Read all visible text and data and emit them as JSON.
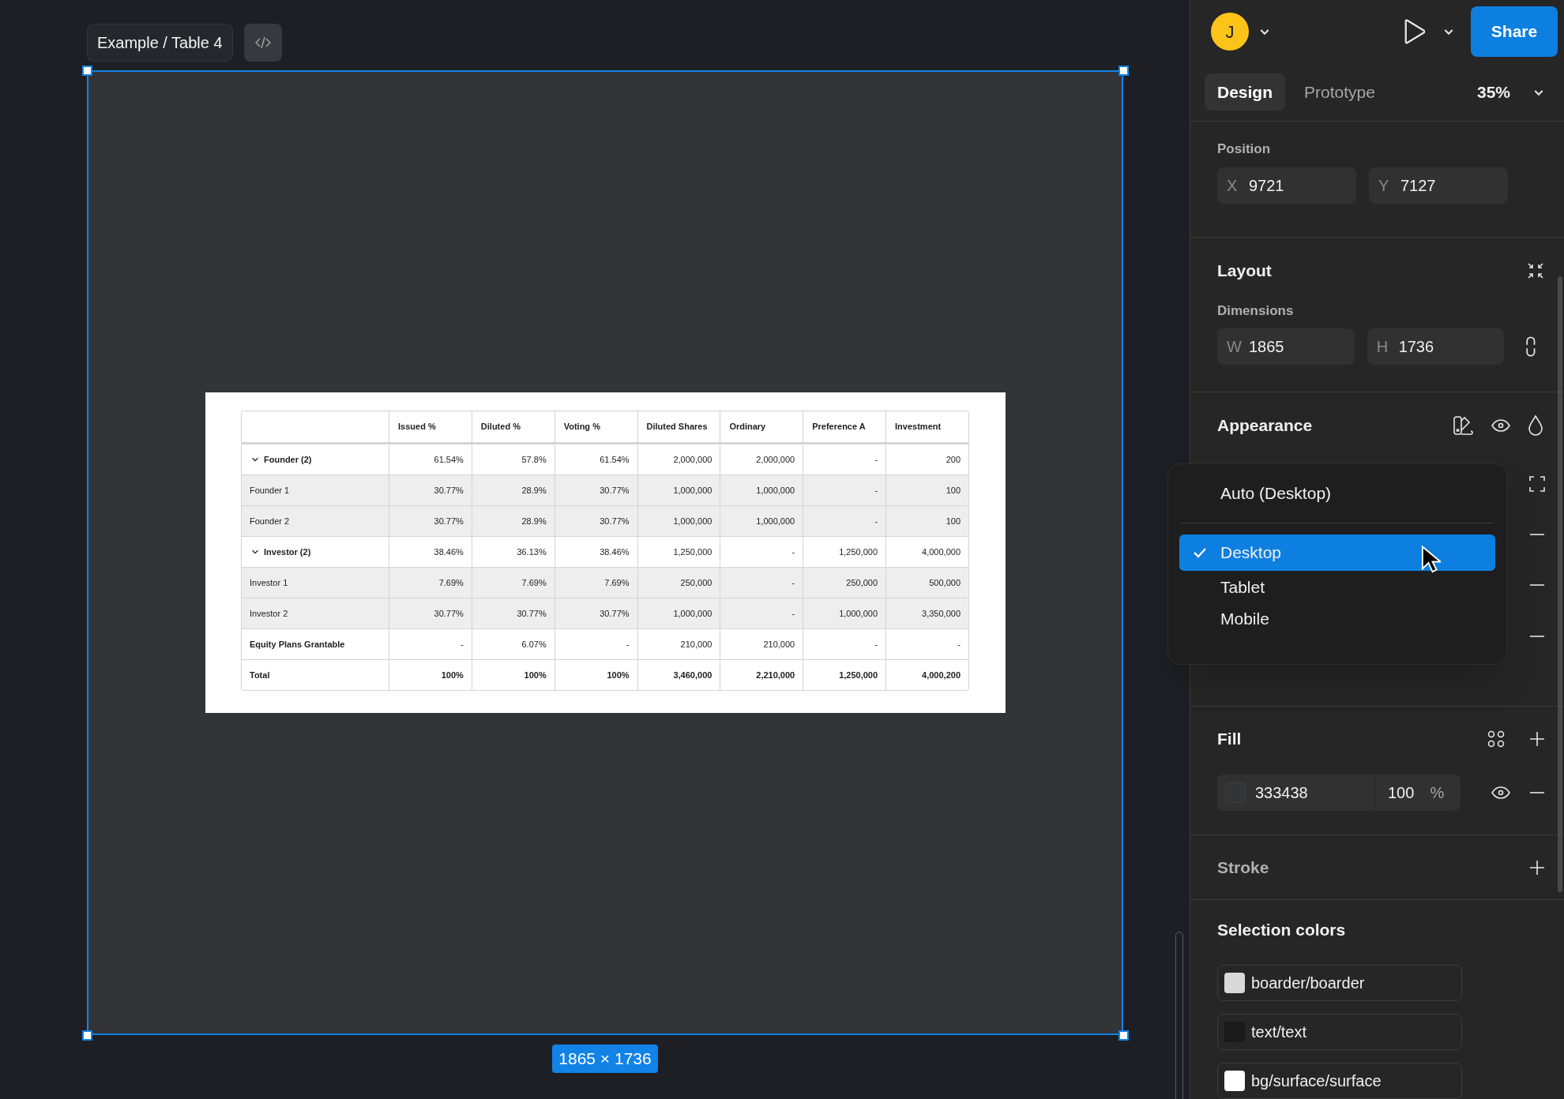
{
  "canvas": {
    "frame_name": "Example / Table 4",
    "frame_size": "1865 × 1736",
    "table": {
      "columns": [
        "",
        "Issued %",
        "Diluted %",
        "Voting %",
        "Diluted Shares",
        "Ordinary",
        "Preference A",
        "Investment"
      ],
      "rows": [
        {
          "kind": "group",
          "expanded": true,
          "cells": [
            "Founder (2)",
            "61.54%",
            "57.8%",
            "61.54%",
            "2,000,000",
            "2,000,000",
            "-",
            "200"
          ]
        },
        {
          "kind": "member",
          "cells": [
            "Founder 1",
            "30.77%",
            "28.9%",
            "30.77%",
            "1,000,000",
            "1,000,000",
            "-",
            "100"
          ]
        },
        {
          "kind": "member",
          "cells": [
            "Founder 2",
            "30.77%",
            "28.9%",
            "30.77%",
            "1,000,000",
            "1,000,000",
            "-",
            "100"
          ]
        },
        {
          "kind": "group",
          "expanded": true,
          "cells": [
            "Investor (2)",
            "38.46%",
            "36.13%",
            "38.46%",
            "1,250,000",
            "-",
            "1,250,000",
            "4,000,000"
          ]
        },
        {
          "kind": "member",
          "cells": [
            "Investor 1",
            "7.69%",
            "7.69%",
            "7.69%",
            "250,000",
            "-",
            "250,000",
            "500,000"
          ]
        },
        {
          "kind": "member",
          "cells": [
            "Investor 2",
            "30.77%",
            "30.77%",
            "30.77%",
            "1,000,000",
            "-",
            "1,000,000",
            "3,350,000"
          ]
        },
        {
          "kind": "plain",
          "cells": [
            "Equity Plans Grantable",
            "-",
            "6.07%",
            "-",
            "210,000",
            "210,000",
            "-",
            "-"
          ]
        },
        {
          "kind": "total",
          "cells": [
            "Total",
            "100%",
            "100%",
            "100%",
            "3,460,000",
            "2,210,000",
            "1,250,000",
            "4,000,200"
          ]
        }
      ]
    }
  },
  "panel": {
    "avatar_initial": "J",
    "share": "Share",
    "tabs": [
      {
        "label": "Design",
        "selected": true
      },
      {
        "label": "Prototype",
        "selected": false
      }
    ],
    "zoom": "35%",
    "position": {
      "title": "Position",
      "fields": [
        {
          "axis": "X",
          "value": "9721"
        },
        {
          "axis": "Y",
          "value": "7127"
        }
      ]
    },
    "layout": {
      "title": "Layout",
      "dimensions_label": "Dimensions",
      "fields": [
        {
          "axis": "W",
          "value": "1865"
        },
        {
          "axis": "H",
          "value": "1736"
        }
      ]
    },
    "appearance": {
      "title": "Appearance"
    },
    "dropdown": {
      "auto_option": "Auto (Desktop)",
      "options": [
        {
          "label": "Desktop",
          "selected": true
        },
        {
          "label": "Tablet",
          "selected": false
        },
        {
          "label": "Mobile",
          "selected": false
        }
      ]
    },
    "fill": {
      "title": "Fill",
      "hex": "333438",
      "opacity": "100",
      "unit": "%"
    },
    "stroke": {
      "title": "Stroke"
    },
    "selection_colors": {
      "title": "Selection colors",
      "items": [
        {
          "name": "boarder/boarder",
          "color": "#d9d9d9"
        },
        {
          "name": "text/text",
          "color": "#1a1a1a"
        },
        {
          "name": "bg/surface/surface",
          "color": "#ffffff"
        }
      ]
    }
  }
}
